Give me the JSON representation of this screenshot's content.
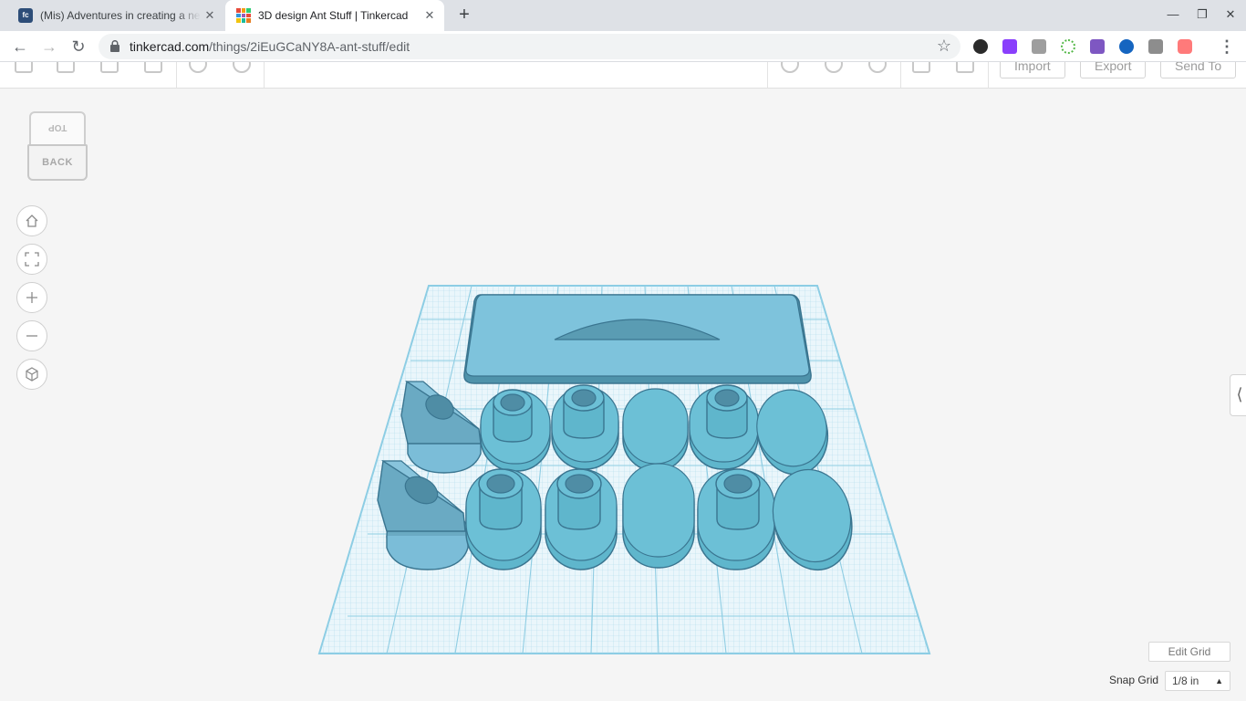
{
  "browser": {
    "tabs": [
      {
        "title": "(Mis) Adventures in creating a ne",
        "favicon": "fc-favicon",
        "active": false
      },
      {
        "title": "3D design Ant Stuff | Tinkercad",
        "favicon": "tinkercad-favicon",
        "active": true
      }
    ],
    "url_host": "tinkercad.com",
    "url_path": "/things/2iEuGCaNY8A-ant-stuff/edit"
  },
  "app": {
    "toolbar": {
      "import_label": "Import",
      "export_label": "Export",
      "send_to_label": "Send To"
    },
    "viewcube": {
      "top_label": "TOP",
      "back_label": "BACK"
    },
    "view_controls": [
      "home-view",
      "fit-view",
      "zoom-in",
      "zoom-out",
      "orthographic-perspective"
    ],
    "edit_grid_label": "Edit Grid",
    "snap_grid_label": "Snap Grid",
    "snap_grid_value": "1/8 in",
    "colors": {
      "shape_fill": "#6cc0d6",
      "shape_top": "#7ac5de",
      "shape_side": "#4d90a8",
      "grid": "#a9d8ea",
      "accent": "#2a7fb0"
    }
  }
}
